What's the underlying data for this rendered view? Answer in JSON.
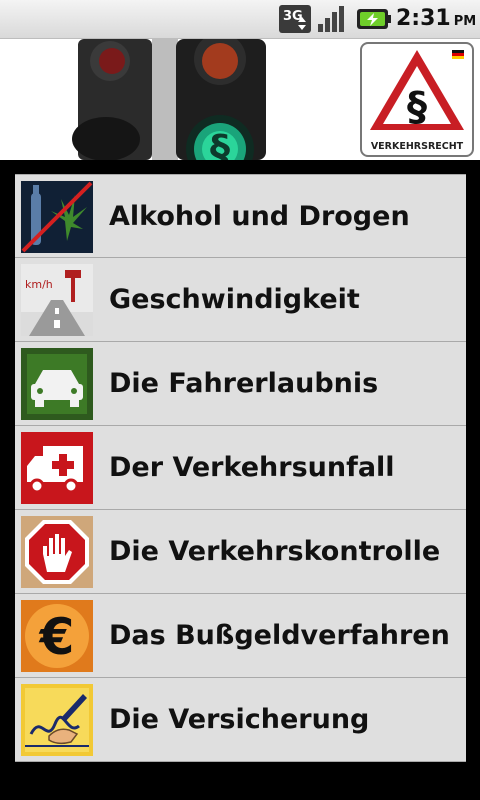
{
  "status_bar": {
    "network": "3G",
    "time": "2:31",
    "ampm": "PM",
    "icons": [
      "network-3g-icon",
      "signal-strength-icon",
      "battery-charging-icon"
    ]
  },
  "header": {
    "logo_text": "VERKEHRSRECHT",
    "logo_symbol": "§",
    "banner_symbol": "§"
  },
  "menu": {
    "items": [
      {
        "label": "Alkohol und Drogen",
        "icon": "alcohol-drugs-icon"
      },
      {
        "label": "Geschwindigkeit",
        "icon": "speed-road-icon"
      },
      {
        "label": "Die Fahrerlaubnis",
        "icon": "car-icon"
      },
      {
        "label": "Der Verkehrsunfall",
        "icon": "ambulance-icon"
      },
      {
        "label": "Die Verkehrskontrolle",
        "icon": "stop-hand-icon"
      },
      {
        "label": "Das Bußgeldverfahren",
        "icon": "euro-icon"
      },
      {
        "label": "Die Versicherung",
        "icon": "signing-pen-icon"
      }
    ]
  },
  "colors": {
    "list_background": "#dfdfdf",
    "app_background": "#000000",
    "warning_red": "#c81e24",
    "traffic_green": "#2bd59a"
  }
}
